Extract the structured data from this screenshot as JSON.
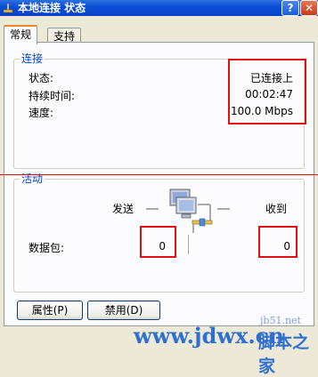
{
  "window": {
    "title": "本地连接 状态",
    "help_glyph": "?",
    "close_glyph": "✕"
  },
  "tabs": [
    {
      "label": "常规",
      "active": true
    },
    {
      "label": "支持",
      "active": false
    }
  ],
  "connection": {
    "group_title": "连接",
    "rows": [
      {
        "label": "状态:",
        "value": "已连接上"
      },
      {
        "label": "持续时间:",
        "value": "00:02:47"
      },
      {
        "label": "速度:",
        "value": "100.0 Mbps"
      }
    ]
  },
  "activity": {
    "group_title": "活动",
    "sent_label": "发送",
    "received_label": "收到",
    "packets_label": "数据包:",
    "packets_sent": "0",
    "packets_received": "0"
  },
  "buttons": {
    "properties": "属性(P)",
    "disable": "禁用(D)"
  },
  "watermark": {
    "site": "jb51.net",
    "url": "www.jdwx.cn",
    "brand": "脚本之家"
  },
  "colors": {
    "titlebar": "#0a4dd6",
    "group_title": "#0046d5",
    "highlight": "#e01010",
    "active_tab": "#e68b2c"
  }
}
